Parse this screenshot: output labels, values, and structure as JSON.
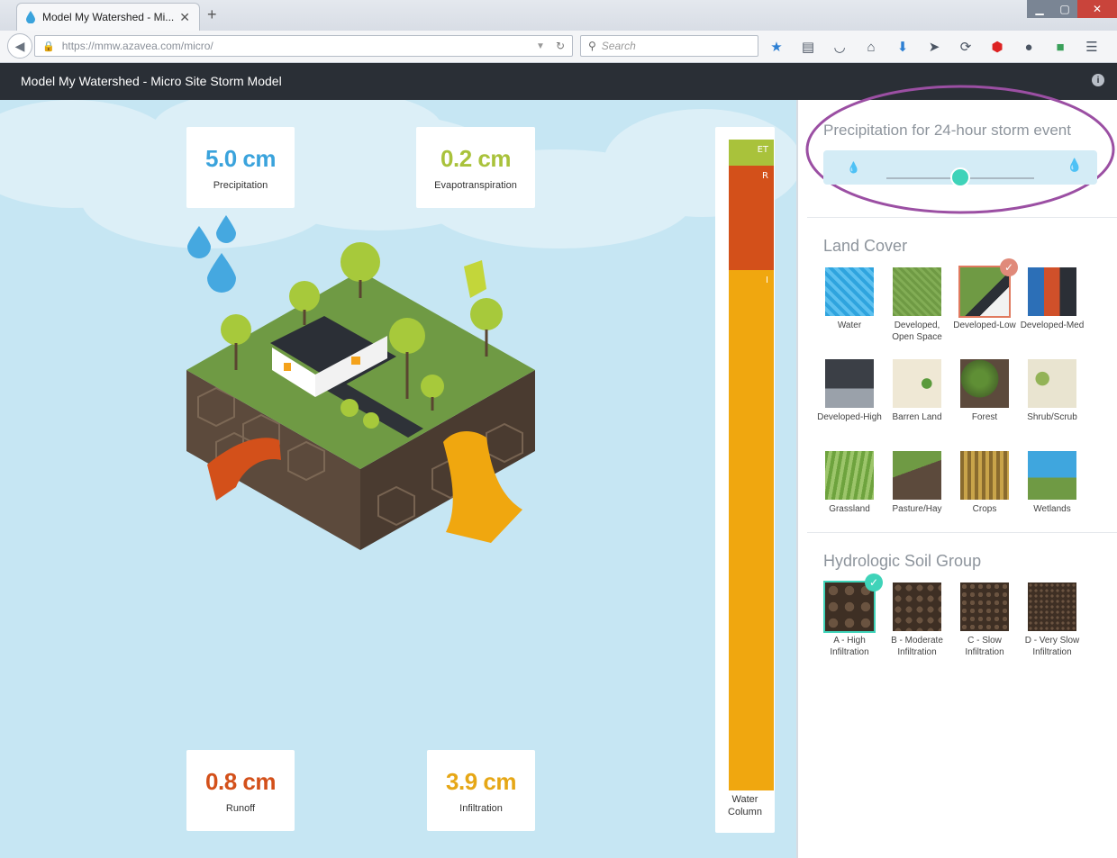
{
  "browser": {
    "tab_title": "Model My Watershed - Mi...",
    "url": "https://mmw.azavea.com/micro/",
    "search_placeholder": "Search"
  },
  "app": {
    "title": "Model My Watershed - Micro Site Storm Model"
  },
  "stats": {
    "precipitation": {
      "value": "5.0 cm",
      "label": "Precipitation",
      "color": "#3aa3dc"
    },
    "evapotranspiration": {
      "value": "0.2 cm",
      "label": "Evapotranspiration",
      "color": "#a9c23b"
    },
    "runoff": {
      "value": "0.8 cm",
      "label": "Runoff",
      "color": "#d3501a"
    },
    "infiltration": {
      "value": "3.9 cm",
      "label": "Infiltration",
      "color": "#e6a716"
    }
  },
  "water_column": {
    "label_line1": "Water",
    "label_line2": "Column",
    "segments": [
      {
        "tag": "ET",
        "fraction": 0.04,
        "color": "#a9c23b"
      },
      {
        "tag": "R",
        "fraction": 0.16,
        "color": "#d3501a"
      },
      {
        "tag": "I",
        "fraction": 0.8,
        "color": "#f0a70f"
      }
    ]
  },
  "precip_control": {
    "title": "Precipitation for 24-hour storm event",
    "slider_fraction": 0.5
  },
  "land_cover": {
    "title": "Land Cover",
    "items": [
      {
        "label": "Water",
        "selected": false
      },
      {
        "label": "Developed, Open Space",
        "selected": false
      },
      {
        "label": "Developed-Low",
        "selected": true
      },
      {
        "label": "Developed-Med",
        "selected": false
      },
      {
        "label": "Developed-High",
        "selected": false
      },
      {
        "label": "Barren Land",
        "selected": false
      },
      {
        "label": "Forest",
        "selected": false
      },
      {
        "label": "Shrub/Scrub",
        "selected": false
      },
      {
        "label": "Grassland",
        "selected": false
      },
      {
        "label": "Pasture/Hay",
        "selected": false
      },
      {
        "label": "Crops",
        "selected": false
      },
      {
        "label": "Wetlands",
        "selected": false
      }
    ]
  },
  "soil_group": {
    "title": "Hydrologic Soil Group",
    "items": [
      {
        "label": "A - High Infiltration",
        "selected": true
      },
      {
        "label": "B - Moderate Infiltration",
        "selected": false
      },
      {
        "label": "C - Slow Infiltration",
        "selected": false
      },
      {
        "label": "D - Very Slow Infiltration",
        "selected": false
      }
    ]
  }
}
